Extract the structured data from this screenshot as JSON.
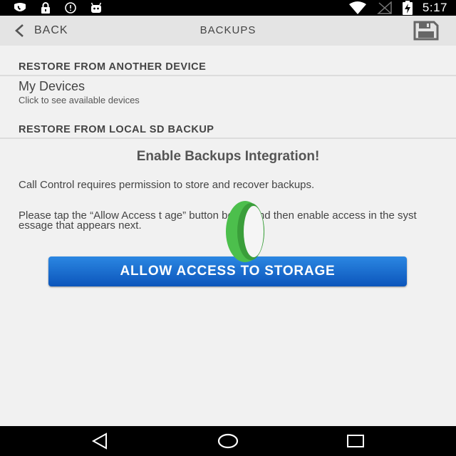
{
  "status_bar": {
    "time": "5:17",
    "left_icons": [
      "phone-shield-icon",
      "lock-icon",
      "info-circle-icon",
      "android-robot-icon"
    ],
    "right_icons": [
      "wifi-icon",
      "no-signal-icon",
      "battery-charging-icon"
    ]
  },
  "action_bar": {
    "back_label": "BACK",
    "title": "BACKUPS",
    "save_icon": "floppy-disk-icon"
  },
  "sections": {
    "remote_header": "RESTORE FROM ANOTHER DEVICE",
    "my_devices": {
      "title": "My Devices",
      "subtitle": "Click to see available devices"
    },
    "local_header": "RESTORE FROM LOCAL SD BACKUP"
  },
  "permission": {
    "title": "Enable Backups Integration!",
    "paragraph_1": "Call Control requires permission to store and recover backups.",
    "paragraph_2": "Please tap the “Allow Access t    age” button below and then enable access in the syst     essage that appears next.",
    "button_label": "ALLOW ACCESS TO STORAGE"
  },
  "nav_bar": {
    "icons": [
      "back-triangle-icon",
      "home-circle-icon",
      "recents-square-icon"
    ]
  },
  "colors": {
    "button_top": "#2b87e2",
    "button_bottom": "#0c55bb",
    "touch_marker": "#4cbf4c"
  }
}
